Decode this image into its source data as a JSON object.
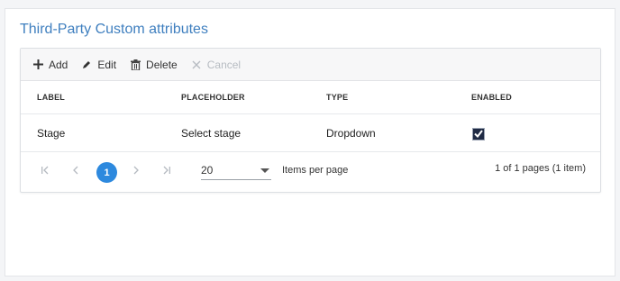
{
  "section": {
    "title": "Third-Party Custom attributes"
  },
  "toolbar": {
    "add_label": "Add",
    "edit_label": "Edit",
    "delete_label": "Delete",
    "cancel_label": "Cancel"
  },
  "table": {
    "headers": [
      "LABEL",
      "PLACEHOLDER",
      "TYPE",
      "ENABLED"
    ],
    "rows": [
      {
        "label": "Stage",
        "placeholder": "Select stage",
        "type": "Dropdown",
        "enabled": true
      }
    ]
  },
  "pager": {
    "current_page": "1",
    "page_size": "20",
    "items_per_page_label": "Items per page",
    "info": "1 of 1 pages (1 item)"
  },
  "colors": {
    "title": "#3f7fbf",
    "accent": "#2d89de",
    "checkbox_fill": "#1f2a44"
  },
  "icons": [
    "plus-icon",
    "pencil-icon",
    "trash-icon",
    "close-icon",
    "first-page-icon",
    "prev-page-icon",
    "next-page-icon",
    "last-page-icon",
    "caret-down-icon",
    "checkmark-icon"
  ]
}
